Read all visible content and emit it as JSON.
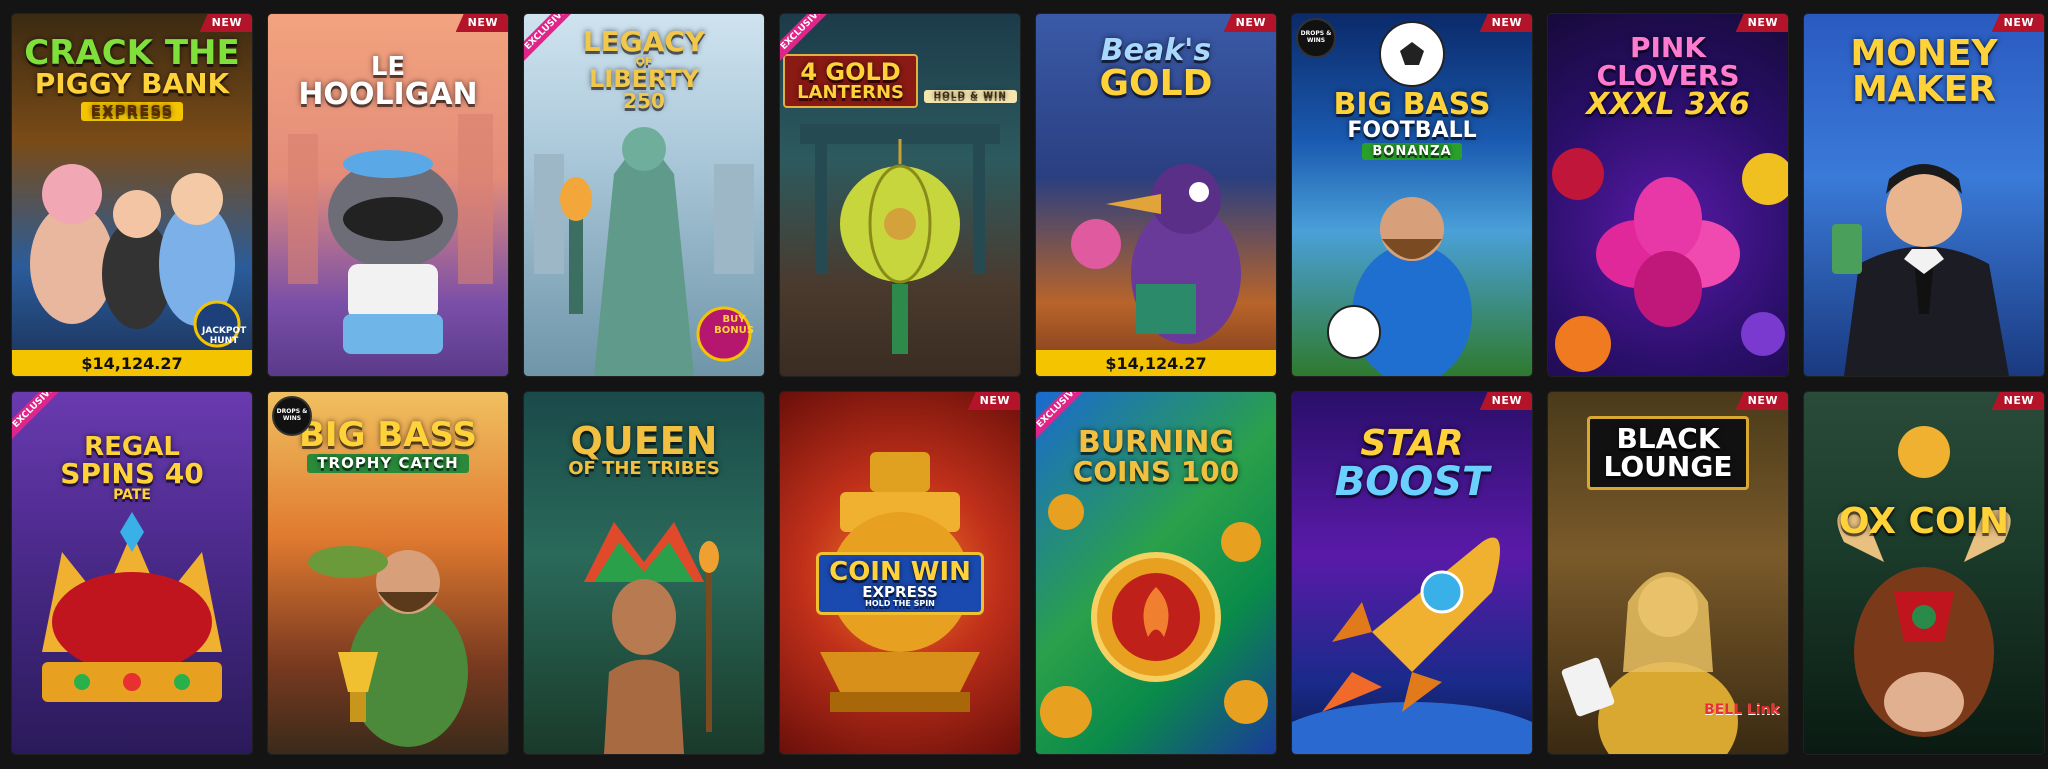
{
  "games": [
    {
      "title_lines": [
        "CRACK THE",
        "PIGGY BANK"
      ],
      "subtitle": "EXPRESS",
      "badge": "NEW",
      "jackpot": "$14,124.27",
      "extra": "JACKPOT HUNT"
    },
    {
      "title_lines": [
        "LE",
        "HOOLIGAN"
      ],
      "badge": "NEW"
    },
    {
      "title_lines": [
        "LEGACY",
        "OF",
        "LIBERTY",
        "250"
      ],
      "ribbon": "EXCLUSIVE",
      "extra": "BUY BONUS"
    },
    {
      "title_lines": [
        "4 GOLD",
        "LANTERNS"
      ],
      "subtitle": "HOLD & WIN",
      "ribbon": "EXCLUSIVE"
    },
    {
      "title_lines": [
        "Beak's",
        "GOLD"
      ],
      "badge": "NEW",
      "jackpot": "$14,124.27"
    },
    {
      "title_lines": [
        "BIG BASS",
        "FOOTBALL"
      ],
      "subtitle": "BONANZA",
      "badge": "NEW",
      "drops": "DROPS & WINS"
    },
    {
      "title_lines": [
        "PINK",
        "CLOVERS",
        "XXXL 3X6"
      ],
      "badge": "NEW"
    },
    {
      "title_lines": [
        "MONEY",
        "MAKER"
      ],
      "badge": "NEW"
    },
    {
      "title_lines": [
        "REGAL",
        "SPINS 40"
      ],
      "subtitle": "PATE",
      "ribbon": "EXCLUSIVE"
    },
    {
      "title_lines": [
        "BIG BASS"
      ],
      "subtitle": "TROPHY CATCH",
      "drops": "DROPS & WINS"
    },
    {
      "title_lines": [
        "QUEEN",
        "OF THE TRIBES"
      ]
    },
    {
      "title_lines": [
        "COIN WIN"
      ],
      "subtitle": "EXPRESS",
      "subtitle2": "HOLD THE SPIN",
      "badge": "NEW"
    },
    {
      "title_lines": [
        "BURNING",
        "COINS 100"
      ],
      "ribbon": "EXCLUSIVE"
    },
    {
      "title_lines": [
        "STAR",
        "BOOST"
      ],
      "badge": "NEW"
    },
    {
      "title_lines": [
        "BLACK",
        "LOUNGE"
      ],
      "badge": "NEW",
      "extra": "BELL Link"
    },
    {
      "title_lines": [
        "OX COIN"
      ],
      "badge": "NEW"
    }
  ],
  "colors": {
    "badge_new": "#b3142a",
    "ribbon_exclusive": "#e0248a",
    "jackpot_bar": "#f5c400",
    "page_bg": "#141414"
  }
}
